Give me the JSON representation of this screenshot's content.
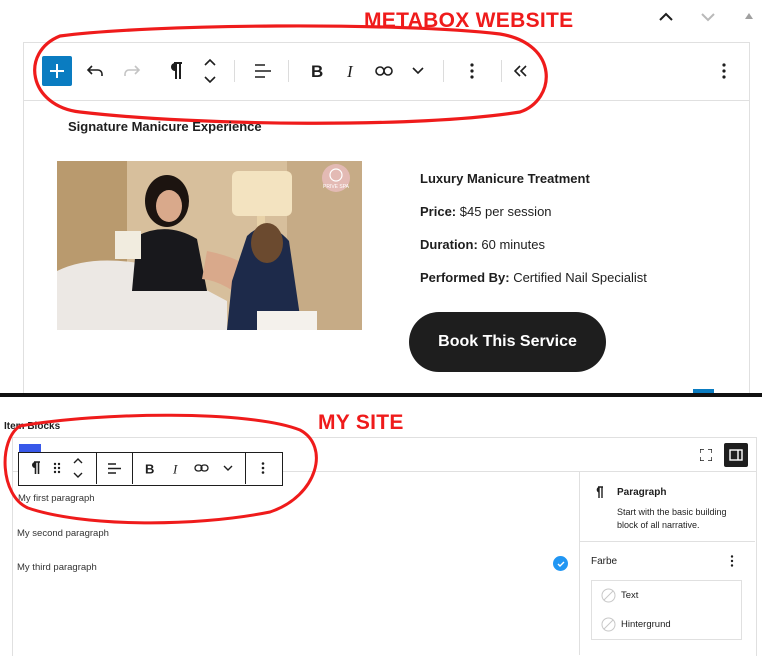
{
  "annotations": {
    "top_label": "METABOX WEBSITE",
    "bottom_label": "MY SITE"
  },
  "top": {
    "section_title": "Signature Manicure Experience",
    "image_badge": "PRIVE SPA",
    "details": {
      "title": "Luxury Manicure Treatment",
      "price_label": "Price:",
      "price_value": " $45 per session",
      "duration_label": "Duration:",
      "duration_value": " 60 minutes",
      "performer_label": "Performed By:",
      "performer_value": " Certified Nail Specialist"
    },
    "book_button": "Book This Service"
  },
  "bottom": {
    "panel_title": "Item Blocks",
    "paragraphs": [
      "My first paragraph",
      "My second paragraph",
      "My third paragraph"
    ],
    "sidebar": {
      "block_name": "Paragraph",
      "block_desc": "Start with the basic building block of all narrative.",
      "color_section": "Farbe",
      "color_items": [
        "Text",
        "Hintergrund"
      ]
    }
  },
  "colors": {
    "accent_blue": "#0a7cc1",
    "annotation_red": "#ef1b1b",
    "check_blue": "#2196f3",
    "button_dark": "#1e1e1e"
  }
}
